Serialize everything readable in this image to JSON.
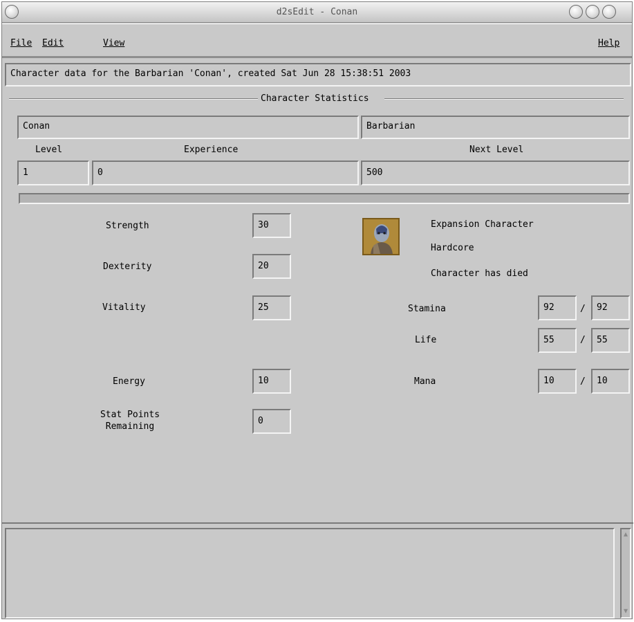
{
  "window": {
    "title": "d2sEdit - Conan"
  },
  "menu": {
    "file": "File",
    "edit": "Edit",
    "view": "View",
    "help": "Help"
  },
  "info_bar": "Character data for the Barbarian 'Conan', created Sat Jun 28 15:38:51 2003",
  "group_title": "Character Statistics",
  "character": {
    "name": "Conan",
    "class": "Barbarian",
    "level_label": "Level",
    "experience_label": "Experience",
    "next_level_label": "Next Level",
    "level": "1",
    "experience": "0",
    "next_level": "500",
    "progress_fraction": 0
  },
  "stats": {
    "strength_label": "Strength",
    "strength": "30",
    "dexterity_label": "Dexterity",
    "dexterity": "20",
    "vitality_label": "Vitality",
    "vitality": "25",
    "energy_label": "Energy",
    "energy": "10",
    "stat_points_label_1": "Stat Points",
    "stat_points_label_2": "Remaining",
    "stat_points": "0"
  },
  "flags": {
    "expansion": "Expansion Character",
    "hardcore": "Hardcore",
    "died": "Character has died"
  },
  "vitals": {
    "stamina_label": "Stamina",
    "stamina_current": "92",
    "stamina_max": "92",
    "life_label": "Life",
    "life_current": "55",
    "life_max": "55",
    "mana_label": "Mana",
    "mana_current": "10",
    "mana_max": "10",
    "separator": "/"
  },
  "icons": {
    "avatar": "barbarian-portrait-icon",
    "scroll_up": "arrow-up-icon",
    "scroll_down": "arrow-down-icon"
  }
}
